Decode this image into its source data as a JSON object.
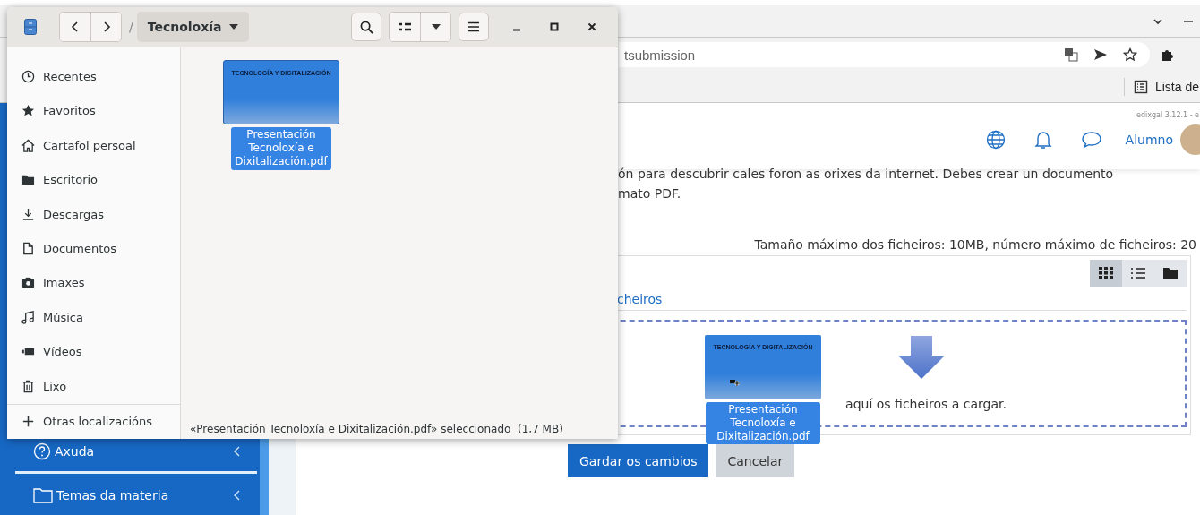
{
  "browser": {
    "address_text": "tsubmission",
    "bookmark": "Lista de"
  },
  "site": {
    "version": "edixgal 3.12.1 - e",
    "user": "Alumno",
    "nav": [
      {
        "label": "Axuda"
      },
      {
        "label": "Temas da materia"
      }
    ]
  },
  "assignment": {
    "description": [
      "ón para descubrir cales foron as orixes da internet. Debes crear un documento",
      "mato PDF."
    ],
    "limits": "Tamaño máximo dos ficheiros: 10MB, número máximo de ficheiros: 20",
    "link": "cheiros",
    "views": [
      {
        "kind": "grid",
        "selected": true
      },
      {
        "kind": "list",
        "selected": false
      },
      {
        "kind": "tree",
        "selected": false
      }
    ],
    "drop_hint": "aquí os ficheiros a cargar.",
    "buttons": [
      {
        "label": "Gardar os cambios",
        "kind": "primary"
      },
      {
        "label": "Cancelar",
        "kind": "secondary"
      }
    ]
  },
  "drag_ghost": {
    "thumbnail_title": "TECNOLOGÍA Y DIGITALIZACIÓN",
    "label": "Presentación Tecnoloxía e Dixitalización.pdf"
  },
  "file_manager": {
    "path_separator": "/",
    "path": "Tecnoloxía",
    "places": [
      {
        "label": "Recentes"
      },
      {
        "label": "Favoritos"
      },
      {
        "label": "Cartafol persoal"
      },
      {
        "label": "Escritorio"
      },
      {
        "label": "Descargas"
      },
      {
        "label": "Documentos"
      },
      {
        "label": "Imaxes"
      },
      {
        "label": "Música"
      },
      {
        "label": "Vídeos"
      },
      {
        "label": "Lixo"
      },
      {
        "label": "Otras localizacións"
      }
    ],
    "files": [
      {
        "name": "Presentación Tecnoloxía e Dixitalización.pdf",
        "thumbnail_title": "TECNOLOGÍA Y DIGITALIZACIÓN",
        "selected": true
      }
    ],
    "status": "«Presentación Tecnoloxía e Dixitalización.pdf» seleccionado",
    "size": "(1,7 MB)"
  }
}
